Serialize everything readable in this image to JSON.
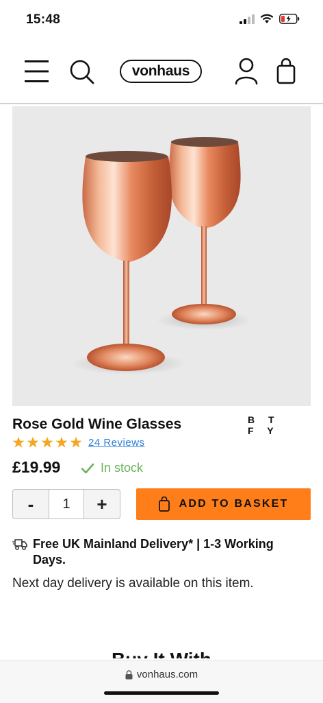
{
  "status": {
    "time": "15:48"
  },
  "header": {
    "logo": "vonhaus",
    "icons": [
      "menu-icon",
      "search-icon",
      "account-icon",
      "basket-icon"
    ]
  },
  "product": {
    "title": "Rose Gold Wine Glasses",
    "brand_line1": "B T",
    "brand_line2": "F Y",
    "rating": 5,
    "reviews": "24 Reviews",
    "price": "£19.99",
    "stock": "In stock",
    "quantity": "1",
    "qty_minus": "-",
    "qty_plus": "+",
    "add_to_basket": "ADD TO BASKET"
  },
  "delivery": {
    "title": "Free UK Mainland Delivery* | 1-3 Working Days.",
    "next_day": "Next day delivery is available on this item."
  },
  "section": {
    "buy_it_with": "Buy It With"
  },
  "browser": {
    "url": "vonhaus.com"
  },
  "colors": {
    "accent": "#ff7e19",
    "star": "#f5a623",
    "link": "#2d7fd8",
    "stock": "#6bb25a"
  }
}
